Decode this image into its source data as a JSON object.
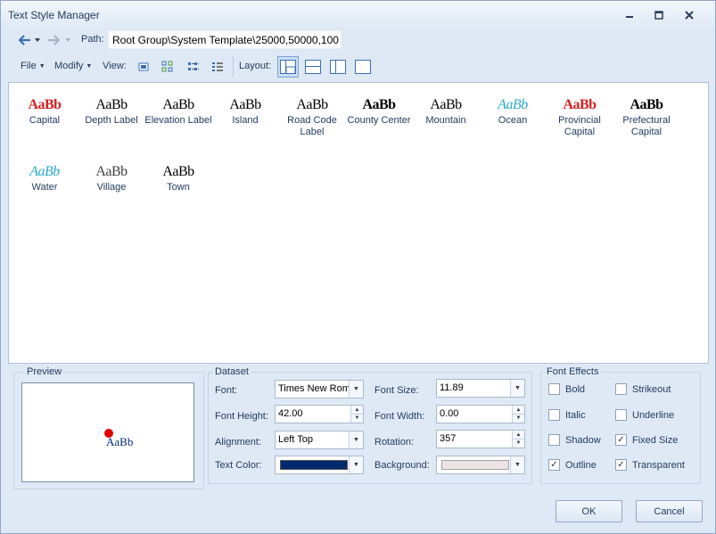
{
  "window": {
    "title": "Text Style Manager"
  },
  "pathbar": {
    "label": "Path:",
    "value": "Root Group\\System Template\\25000,50000,100"
  },
  "toolbar": {
    "file": "File",
    "modify": "Modify",
    "view": "View:",
    "layout": "Layout:"
  },
  "styles": [
    {
      "label": "Capital",
      "sample": "AaBb",
      "color": "#d42020",
      "bold": true,
      "italic": false
    },
    {
      "label": "Depth Label",
      "sample": "AaBb",
      "color": "#000000",
      "bold": false,
      "italic": false
    },
    {
      "label": "Elevation Label",
      "sample": "AaBb",
      "color": "#000000",
      "bold": false,
      "italic": false
    },
    {
      "label": "Island",
      "sample": "AaBb",
      "color": "#000000",
      "bold": false,
      "italic": false
    },
    {
      "label": "Road Code Label",
      "sample": "AaBb",
      "color": "#000000",
      "bold": false,
      "italic": false
    },
    {
      "label": "County Center",
      "sample": "AaBb",
      "color": "#000000",
      "bold": true,
      "italic": false
    },
    {
      "label": "Mountain",
      "sample": "AaBb",
      "color": "#000000",
      "bold": false,
      "italic": false
    },
    {
      "label": "Ocean",
      "sample": "AaBb",
      "color": "#2aa7c9",
      "bold": false,
      "italic": true
    },
    {
      "label": "Provincial Capital",
      "sample": "AaBb",
      "color": "#d42020",
      "bold": true,
      "italic": false
    },
    {
      "label": "Prefectural Capital",
      "sample": "AaBb",
      "color": "#000000",
      "bold": true,
      "italic": false
    },
    {
      "label": "Water",
      "sample": "AaBb",
      "color": "#2aa7c9",
      "bold": false,
      "italic": true
    },
    {
      "label": "Village",
      "sample": "AaBb",
      "color": "#404040",
      "bold": false,
      "italic": false
    },
    {
      "label": "Town",
      "sample": "AaBb",
      "color": "#000000",
      "bold": false,
      "italic": false
    }
  ],
  "preview": {
    "group": "Preview",
    "sample": "AaBb",
    "sample_color": "#002a6e",
    "anchor_color": "#e00000"
  },
  "dataset": {
    "group": "Dataset",
    "font_label": "Font:",
    "font_value": "Times New Roman",
    "font_height_label": "Font Height:",
    "font_height_value": "42.00",
    "alignment_label": "Alignment:",
    "alignment_value": "Left Top",
    "text_color_label": "Text Color:",
    "text_color": "#002a6e",
    "font_size_label": "Font Size:",
    "font_size_value": "11.89",
    "font_width_label": "Font Width:",
    "font_width_value": "0.00",
    "rotation_label": "Rotation:",
    "rotation_value": "357",
    "background_label": "Background:",
    "background_color": "#ece4e4"
  },
  "effects": {
    "group": "Font Effects",
    "items": [
      {
        "label": "Bold",
        "checked": false
      },
      {
        "label": "Strikeout",
        "checked": false
      },
      {
        "label": "Italic",
        "checked": false
      },
      {
        "label": "Underline",
        "checked": false
      },
      {
        "label": "Shadow",
        "checked": false
      },
      {
        "label": "Fixed Size",
        "checked": true
      },
      {
        "label": "Outline",
        "checked": true
      },
      {
        "label": "Transparent",
        "checked": true
      }
    ]
  },
  "buttons": {
    "ok": "OK",
    "cancel": "Cancel"
  }
}
